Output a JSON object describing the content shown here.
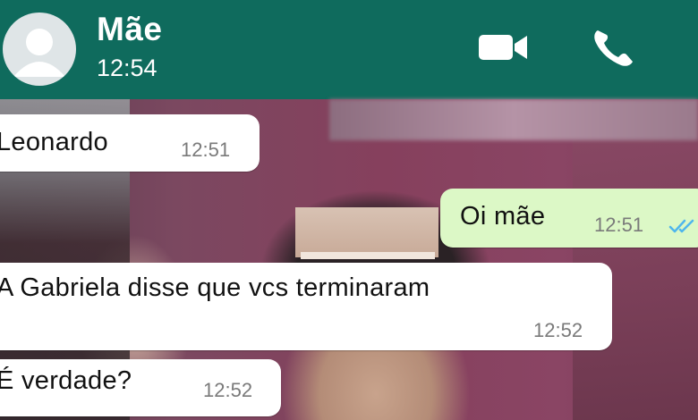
{
  "header": {
    "contact_name": "Mãe",
    "status_time": "12:54",
    "avatar_icon": "default-avatar-icon",
    "actions": [
      {
        "name": "video-call-icon"
      },
      {
        "name": "voice-call-icon"
      }
    ]
  },
  "messages": [
    {
      "direction": "incoming",
      "text": "Leonardo",
      "time": "12:51"
    },
    {
      "direction": "outgoing",
      "text": "Oi mãe",
      "time": "12:51",
      "status": "read",
      "status_icon": "double-check-icon"
    },
    {
      "direction": "incoming",
      "text": "A Gabriela disse que vcs terminaram",
      "time": "12:52"
    },
    {
      "direction": "incoming",
      "text": "É verdade?",
      "time": "12:52"
    }
  ],
  "colors": {
    "header_bg": "#0f6b5d",
    "incoming_bubble": "#ffffff",
    "outgoing_bubble": "#dcf8c6",
    "read_ticks": "#4fb6ec"
  }
}
